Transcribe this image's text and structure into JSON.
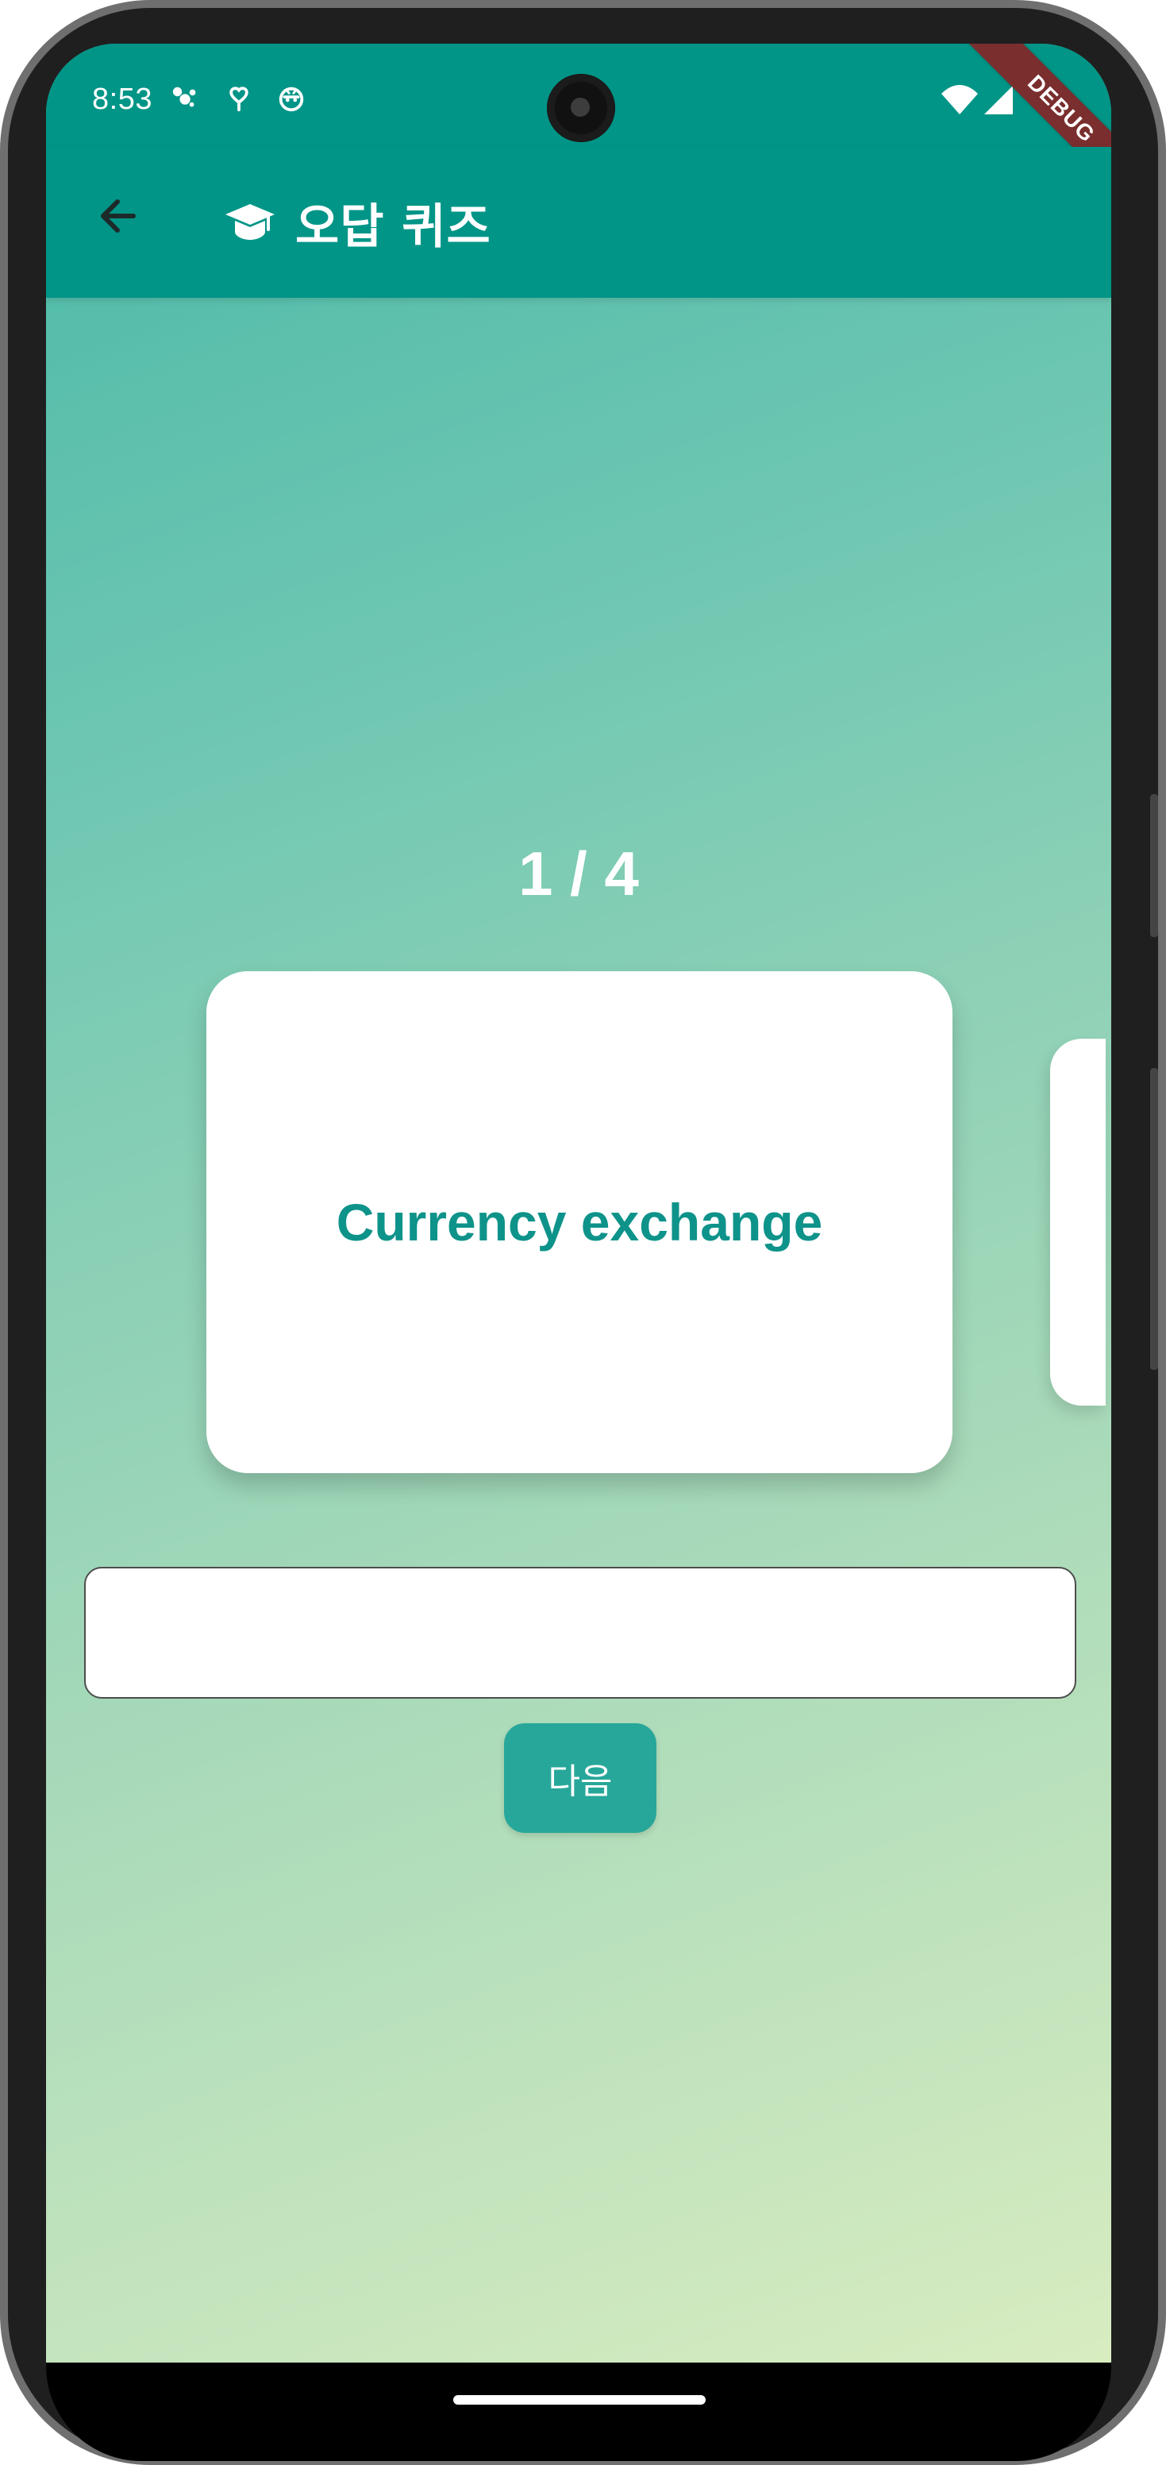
{
  "status": {
    "time": "8:53"
  },
  "badge": {
    "debug_label": "DEBUG"
  },
  "appbar": {
    "title": "오답 퀴즈"
  },
  "quiz": {
    "counter": "1 / 4",
    "word": "Currency exchange"
  },
  "answer": {
    "value": ""
  },
  "actions": {
    "next_label": "다음"
  },
  "colors": {
    "primary": "#009587",
    "card_text": "#0e938a",
    "button": "#27a79a"
  },
  "icons": {
    "back": "arrow-left",
    "title": "graduation-cap",
    "status_left": [
      "assistant-dots",
      "heart-location",
      "robot-face"
    ],
    "status_right": [
      "wifi",
      "cellular"
    ]
  }
}
